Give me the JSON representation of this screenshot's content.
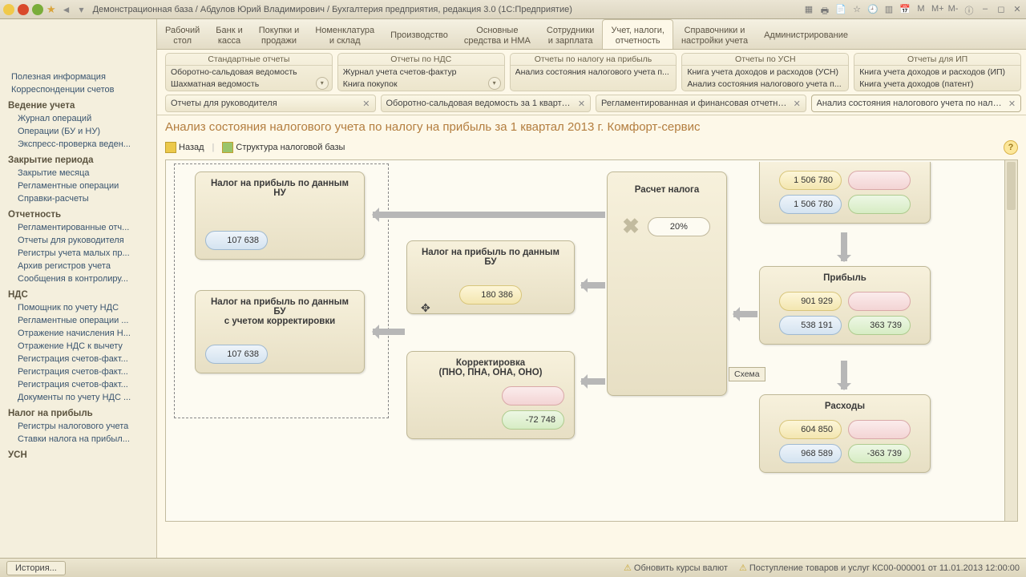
{
  "title": "Демонстрационная база / Абдулов Юрий Владимирович / Бухгалтерия предприятия, редакция 3.0  (1С:Предприятие)",
  "nav": [
    "Рабочий\nстол",
    "Банк и\nкасса",
    "Покупки и\nпродажи",
    "Номенклатура\nи склад",
    "Производство",
    "Основные\nсредства и НМА",
    "Сотрудники\nи зарплата",
    "Учет, налоги,\nотчетность",
    "Справочники и\nнастройки учета",
    "Администрирование"
  ],
  "nav_active": 7,
  "groups": [
    {
      "head": "Стандартные отчеты",
      "lines": [
        "Оборотно-сальдовая ведомость",
        "Шахматная ведомость"
      ],
      "dd": true
    },
    {
      "head": "Отчеты по НДС",
      "lines": [
        "Журнал учета счетов-фактур",
        "Книга покупок"
      ],
      "dd": true
    },
    {
      "head": "Отчеты по налогу на прибыль",
      "lines": [
        "Анализ состояния налогового учета п..."
      ],
      "dd": false
    },
    {
      "head": "Отчеты по УСН",
      "lines": [
        "Книга учета доходов и расходов (УСН)",
        "Анализ состояния налогового учета п..."
      ],
      "dd": false
    },
    {
      "head": "Отчеты для ИП",
      "lines": [
        "Книга учета доходов и расходов (ИП)",
        "Книга учета доходов (патент)"
      ],
      "dd": false
    }
  ],
  "doctabs": [
    "Отчеты для руководителя",
    "Оборотно-сальдовая ведомость за 1 кварта...",
    "Регламентированная и финансовая отчетнос...",
    "Анализ состояния налогового учета по нало..."
  ],
  "doctab_active": 3,
  "sidebar": {
    "top": [
      "Полезная информация",
      "Корреспонденции счетов"
    ],
    "sections": [
      {
        "title": "Ведение учета",
        "items": [
          "Журнал операций",
          "Операции (БУ и НУ)",
          "Экспресс-проверка веден..."
        ]
      },
      {
        "title": "Закрытие периода",
        "items": [
          "Закрытие месяца",
          "Регламентные операции",
          "Справки-расчеты"
        ]
      },
      {
        "title": "Отчетность",
        "items": [
          "Регламентированные отч...",
          "Отчеты для руководителя",
          "Регистры учета малых пр...",
          "Архив регистров учета",
          "Сообщения в контролиру..."
        ]
      },
      {
        "title": "НДС",
        "items": [
          "Помощник по учету НДС",
          "Регламентные операции ...",
          "Отражение начисления Н...",
          "Отражение НДС к вычету",
          "Регистрация счетов-факт...",
          "Регистрация счетов-факт...",
          "Регистрация счетов-факт...",
          "Документы по учету НДС ..."
        ]
      },
      {
        "title": "Налог на прибыль",
        "items": [
          "Регистры налогового учета",
          "Ставки налога на прибыл..."
        ]
      },
      {
        "title": "УСН",
        "items": []
      }
    ]
  },
  "heading": "Анализ состояния налогового учета по налогу на прибыль за 1 квартал 2013 г. Комфорт-сервис",
  "toolbar": {
    "back": "Назад",
    "struct": "Структура налоговой базы"
  },
  "schema_label": "Схема",
  "cards": {
    "nu": {
      "title": "Налог на прибыль по данным НУ",
      "v": "107 638"
    },
    "bu_corr": {
      "title": "Налог на прибыль по данным БУ\nс учетом корректировки",
      "v": "107 638"
    },
    "bu": {
      "title": "Налог на прибыль по данным БУ",
      "v": "180 386"
    },
    "corr": {
      "title": "Корректировка\n(ПНО, ПНА, ОНА, ОНО)",
      "v1": "",
      "v2": "-72 748"
    },
    "calc": {
      "title": "Расчет налога",
      "rate": "20%"
    },
    "income": {
      "v1": "1 506 780",
      "v2": "1 506 780"
    },
    "profit": {
      "title": "Прибыль",
      "y": "901 929",
      "b": "538 191",
      "g": "363 739"
    },
    "expense": {
      "title": "Расходы",
      "y": "604 850",
      "b": "968 589",
      "g": "-363 739"
    }
  },
  "status": {
    "history": "История...",
    "warn1": "Обновить курсы валют",
    "warn2": "Поступление товаров и услуг КС00-000001 от 11.01.2013 12:00:00"
  }
}
